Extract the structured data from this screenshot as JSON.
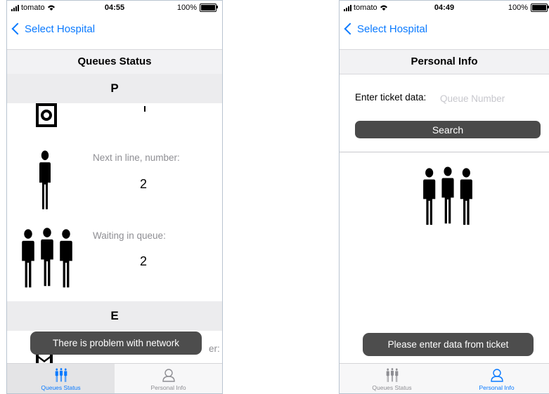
{
  "left_screen": {
    "status": {
      "carrier": "tomato",
      "time": "04:55",
      "battery": "100%"
    },
    "nav": {
      "back_label": "Select Hospital"
    },
    "title": "Queues Status",
    "sections": [
      {
        "name": "P",
        "next_label": "Next in line, number:",
        "next_value": "2",
        "waiting_label": "Waiting in queue:",
        "waiting_value": "2"
      },
      {
        "name": "E",
        "partial_label": "er:"
      }
    ],
    "toast": "There is problem with network",
    "tabs": [
      {
        "label": "Queues Status",
        "active": true
      },
      {
        "label": "Personal Info",
        "active": false
      }
    ]
  },
  "right_screen": {
    "status": {
      "carrier": "tomato",
      "time": "04:49",
      "battery": "100%"
    },
    "nav": {
      "back_label": "Select Hospital"
    },
    "title": "Personal Info",
    "form": {
      "label": "Enter ticket data:",
      "placeholder": "Queue Number",
      "value": "",
      "search_label": "Search"
    },
    "toast": "Please enter data from ticket",
    "tabs": [
      {
        "label": "Queues Status",
        "active": false
      },
      {
        "label": "Personal Info",
        "active": true
      }
    ]
  },
  "colors": {
    "accent": "#0a7aff",
    "toast_bg": "#4d4d4d",
    "section_bg": "#ececee",
    "inactive_tab": "#8e8e93"
  },
  "icons": [
    "wifi-icon",
    "back-chevron-icon",
    "ticket-icon",
    "person-icon",
    "group-icon",
    "partial-queue-icon",
    "queues-tab-icon",
    "personal-info-tab-icon"
  ]
}
